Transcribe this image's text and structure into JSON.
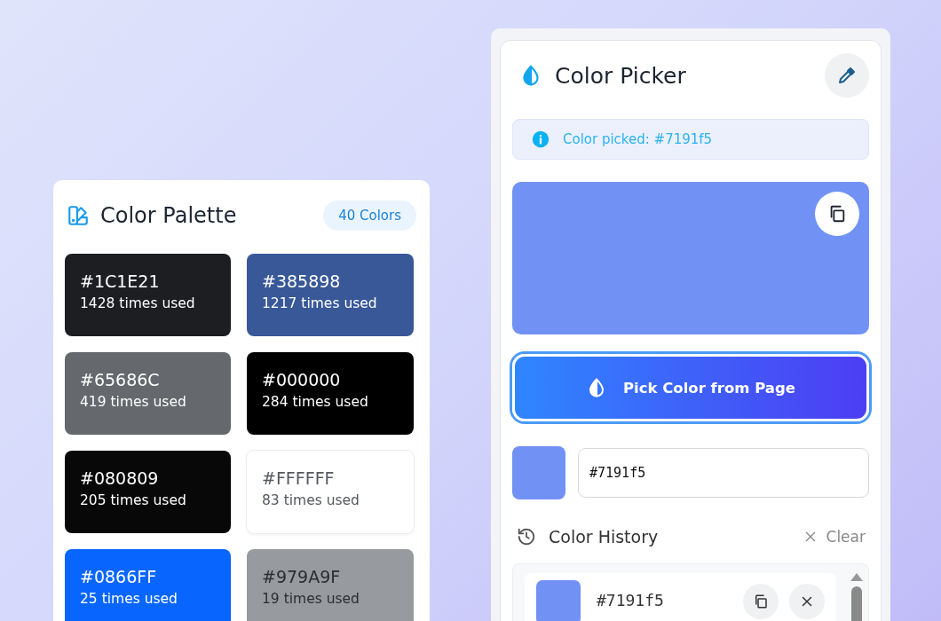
{
  "palette": {
    "title": "Color Palette",
    "count_badge": "40 Colors",
    "swatches": [
      {
        "hex": "#1C1E21",
        "usage": "1428 times used",
        "color": "#1c1e21"
      },
      {
        "hex": "#385898",
        "usage": "1217 times used",
        "color": "#385898"
      },
      {
        "hex": "#65686C",
        "usage": "419 times used",
        "color": "#65686c"
      },
      {
        "hex": "#000000",
        "usage": "284 times used",
        "color": "#000000"
      },
      {
        "hex": "#080809",
        "usage": "205 times used",
        "color": "#080809"
      },
      {
        "hex": "#FFFFFF",
        "usage": "83 times used",
        "color": "#ffffff"
      },
      {
        "hex": "#0866FF",
        "usage": "25 times used",
        "color": "#0866ff"
      },
      {
        "hex": "#979A9F",
        "usage": "19 times used",
        "color": "#979a9f"
      }
    ]
  },
  "picker": {
    "title": "Color Picker",
    "alert": "Color picked: #7191f5",
    "pick_button": "Pick Color from Page",
    "hex_value": "#7191f5",
    "history": {
      "title": "Color History",
      "clear": "Clear",
      "items": [
        {
          "hex": "#7191f5"
        }
      ]
    }
  }
}
